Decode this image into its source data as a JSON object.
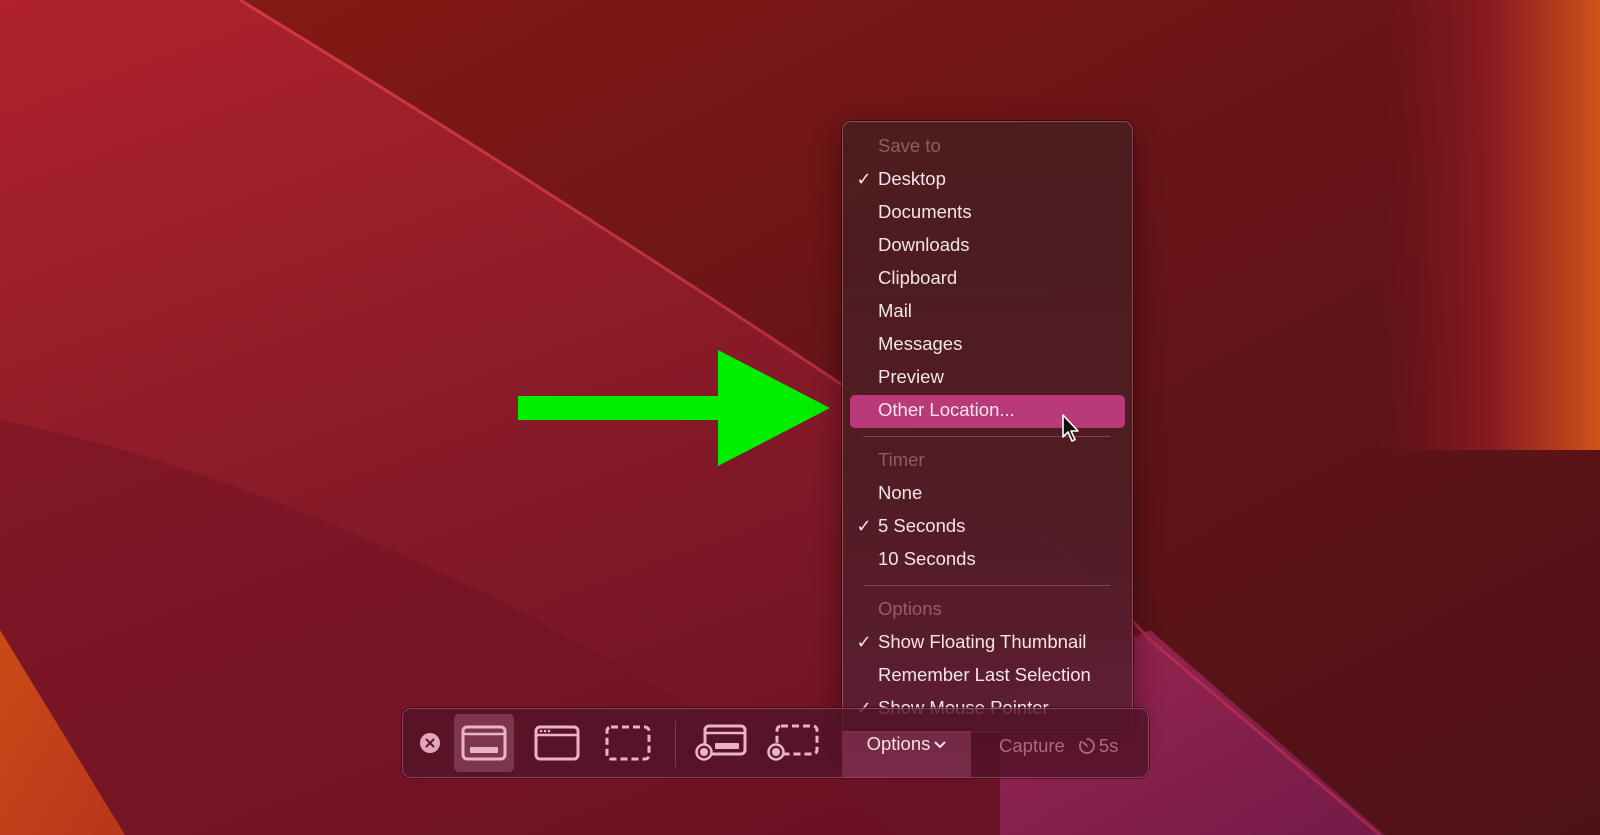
{
  "wallpaper": {
    "colors": {
      "top_left": "#a8222e",
      "band_dark": "#6b1419",
      "right_orange": "#c8501c",
      "bottom_left_orange": "#c4441a",
      "bottom_right_magenta": "#8a1e50"
    }
  },
  "annotation": {
    "arrow_color": "#00ee00",
    "points_to": "Other Location..."
  },
  "menu": {
    "sections": [
      {
        "header": "Save to",
        "items": [
          {
            "label": "Desktop",
            "checked": true,
            "highlighted": false
          },
          {
            "label": "Documents",
            "checked": false,
            "highlighted": false
          },
          {
            "label": "Downloads",
            "checked": false,
            "highlighted": false
          },
          {
            "label": "Clipboard",
            "checked": false,
            "highlighted": false
          },
          {
            "label": "Mail",
            "checked": false,
            "highlighted": false
          },
          {
            "label": "Messages",
            "checked": false,
            "highlighted": false
          },
          {
            "label": "Preview",
            "checked": false,
            "highlighted": false
          },
          {
            "label": "Other Location...",
            "checked": false,
            "highlighted": true
          }
        ]
      },
      {
        "header": "Timer",
        "items": [
          {
            "label": "None",
            "checked": false,
            "highlighted": false
          },
          {
            "label": "5 Seconds",
            "checked": true,
            "highlighted": false
          },
          {
            "label": "10 Seconds",
            "checked": false,
            "highlighted": false
          }
        ]
      },
      {
        "header": "Options",
        "items": [
          {
            "label": "Show Floating Thumbnail",
            "checked": true,
            "highlighted": false
          },
          {
            "label": "Remember Last Selection",
            "checked": false,
            "highlighted": false
          },
          {
            "label": "Show Mouse Pointer",
            "checked": true,
            "highlighted": false
          }
        ]
      }
    ],
    "check_glyph": "✓",
    "highlight_color": "#b83a78"
  },
  "toolbar": {
    "buttons": [
      {
        "icon": "close-icon",
        "label": "Close"
      },
      {
        "icon": "capture-entire-screen-icon",
        "label": "Capture Entire Screen",
        "active": true
      },
      {
        "icon": "capture-window-icon",
        "label": "Capture Selected Window"
      },
      {
        "icon": "capture-selection-icon",
        "label": "Capture Selected Portion"
      },
      {
        "icon": "record-entire-screen-icon",
        "label": "Record Entire Screen"
      },
      {
        "icon": "record-selection-icon",
        "label": "Record Selected Portion"
      }
    ],
    "options_label": "Options",
    "capture_label": "Capture",
    "timer_value": "5s"
  }
}
